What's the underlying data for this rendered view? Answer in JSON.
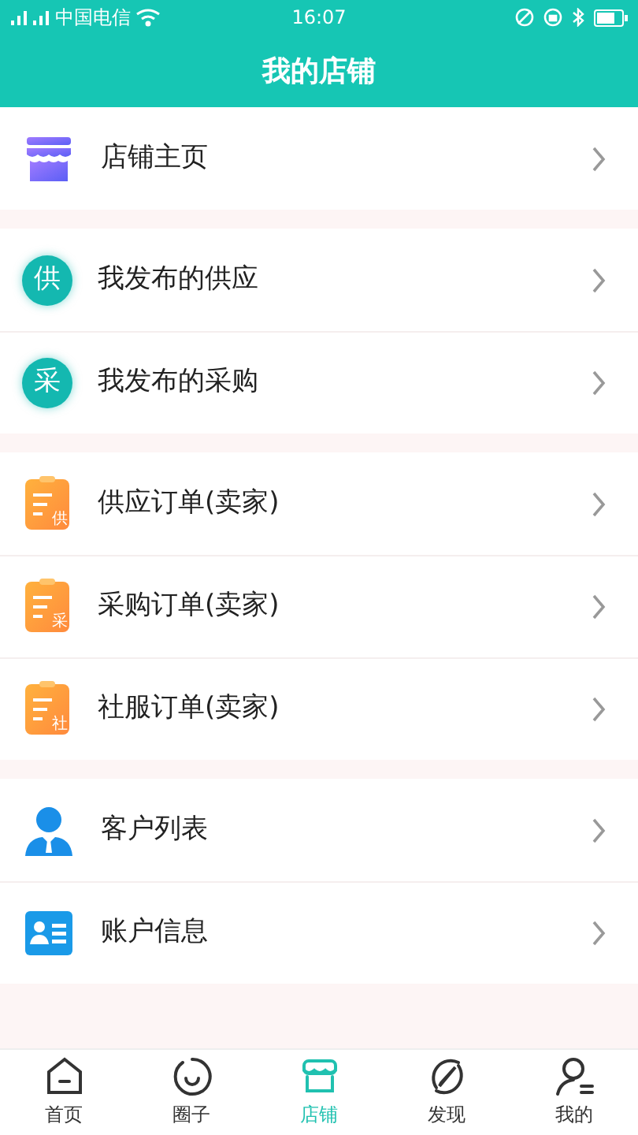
{
  "status_bar": {
    "carrier": "中国电信",
    "time": "16:07"
  },
  "header": {
    "title": "我的店铺"
  },
  "groups": [
    {
      "items": [
        {
          "kind": "store",
          "label": "店铺主页"
        }
      ]
    },
    {
      "items": [
        {
          "kind": "circle",
          "glyph": "供",
          "label": "我发布的供应"
        },
        {
          "kind": "circle",
          "glyph": "采",
          "label": "我发布的采购"
        }
      ]
    },
    {
      "items": [
        {
          "kind": "clipboard",
          "glyph": "供",
          "label": "供应订单(卖家)"
        },
        {
          "kind": "clipboard",
          "glyph": "采",
          "label": "采购订单(卖家)"
        },
        {
          "kind": "clipboard",
          "glyph": "社",
          "label": "社服订单(卖家)"
        }
      ]
    },
    {
      "items": [
        {
          "kind": "person",
          "label": "客户列表"
        },
        {
          "kind": "card",
          "label": "账户信息"
        }
      ]
    }
  ],
  "tabs": [
    {
      "kind": "home",
      "label": "首页",
      "selected": false
    },
    {
      "kind": "circle",
      "label": "圈子",
      "selected": false
    },
    {
      "kind": "store",
      "label": "店铺",
      "selected": true
    },
    {
      "kind": "compass",
      "label": "发现",
      "selected": false
    },
    {
      "kind": "user",
      "label": "我的",
      "selected": false
    }
  ]
}
